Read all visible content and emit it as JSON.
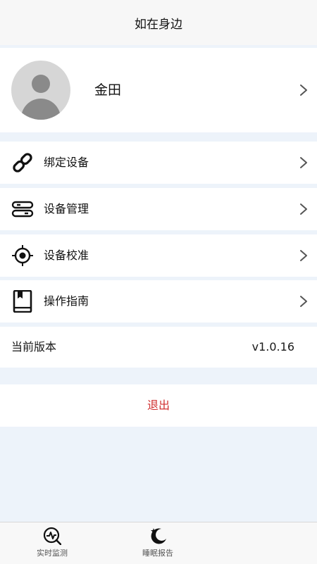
{
  "header": {
    "title": "如在身边"
  },
  "profile": {
    "name": "金田"
  },
  "menu": {
    "items": [
      {
        "label": "绑定设备",
        "icon": "link-icon"
      },
      {
        "label": "设备管理",
        "icon": "device-list-icon"
      },
      {
        "label": "设备校准",
        "icon": "target-icon"
      },
      {
        "label": "操作指南",
        "icon": "book-icon"
      }
    ]
  },
  "version": {
    "label": "当前版本",
    "value": "v1.0.16"
  },
  "logout": {
    "label": "退出"
  },
  "tabbar": {
    "tabs": [
      {
        "label": "实时监测",
        "icon": "monitor-icon"
      },
      {
        "label": "睡眠报告",
        "icon": "moon-icon"
      },
      {
        "label": "",
        "icon": ""
      }
    ]
  },
  "colors": {
    "background": "#edf3fa",
    "logout_text": "#d03030"
  }
}
